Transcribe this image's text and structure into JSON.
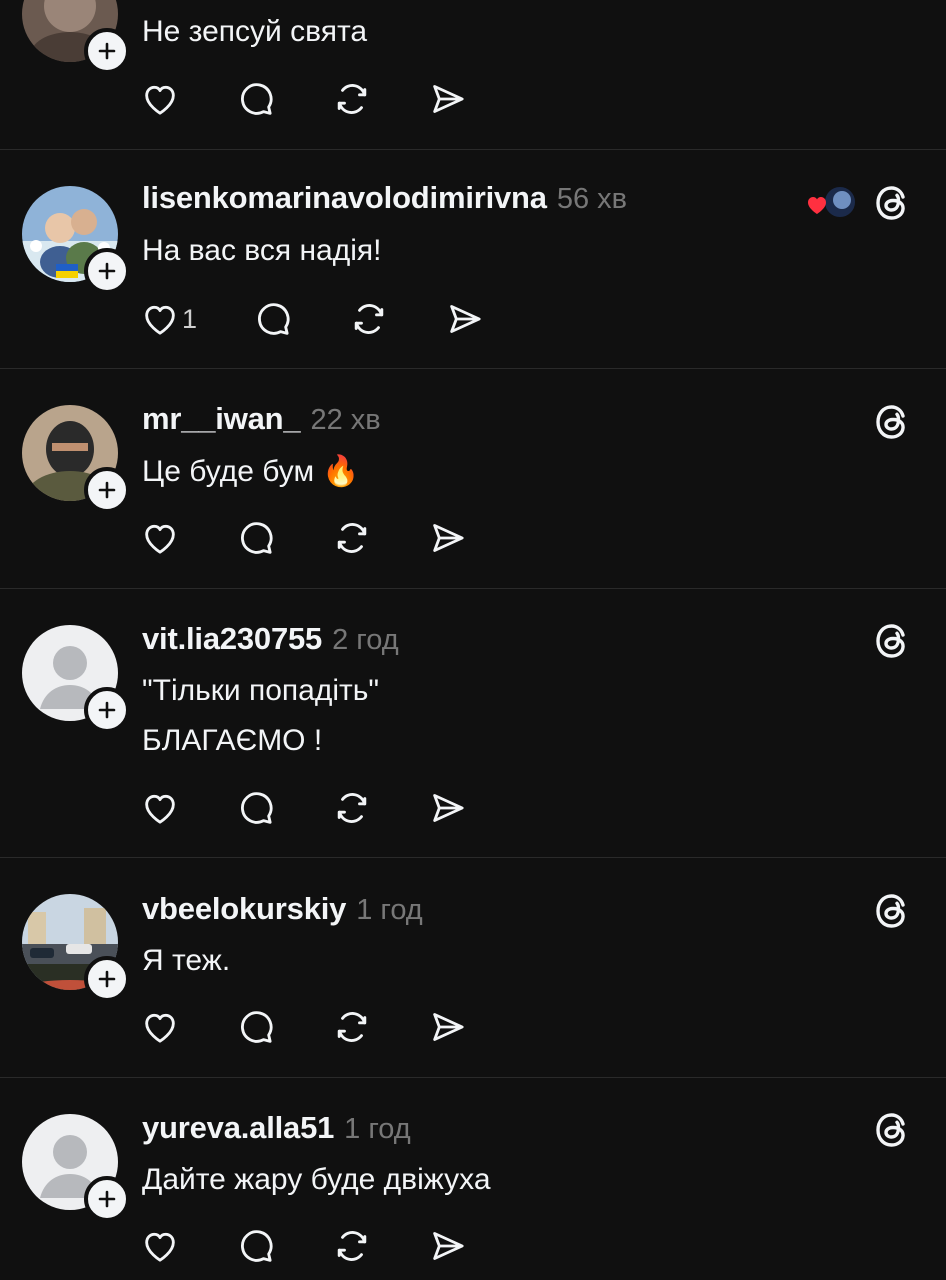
{
  "colors": {
    "background": "#101010",
    "divider": "#2a2a2a",
    "text": "#f3f5f7",
    "muted": "#777777",
    "like_red": "#ff3040"
  },
  "icons": {
    "like": "heart-icon",
    "reply": "speech-bubble-icon",
    "repost": "repost-icon",
    "share": "paper-plane-icon",
    "follow": "plus-icon",
    "app": "threads-logo-icon"
  },
  "posts": [
    {
      "username": "",
      "time": "",
      "lines": [
        "Не зепсуй свята"
      ],
      "likes": ""
    },
    {
      "username": "lisenkomarinavolodimirivna",
      "time": "56 хв",
      "lines": [
        "На вас вся надія!"
      ],
      "likes": "1"
    },
    {
      "username": "mr__iwan_",
      "time": "22 хв",
      "lines": [
        "Це буде бум 🔥"
      ],
      "likes": ""
    },
    {
      "username": "vit.lia230755",
      "time": "2 год",
      "lines": [
        "\"Тільки попадіть\"",
        "БЛАГАЄМО !"
      ],
      "likes": ""
    },
    {
      "username": "vbeelokurskiy",
      "time": "1 год",
      "lines": [
        "Я теж."
      ],
      "likes": ""
    },
    {
      "username": "yureva.alla51",
      "time": "1 год",
      "lines": [
        "Дайте жару буде двіжуха"
      ],
      "likes": ""
    }
  ]
}
